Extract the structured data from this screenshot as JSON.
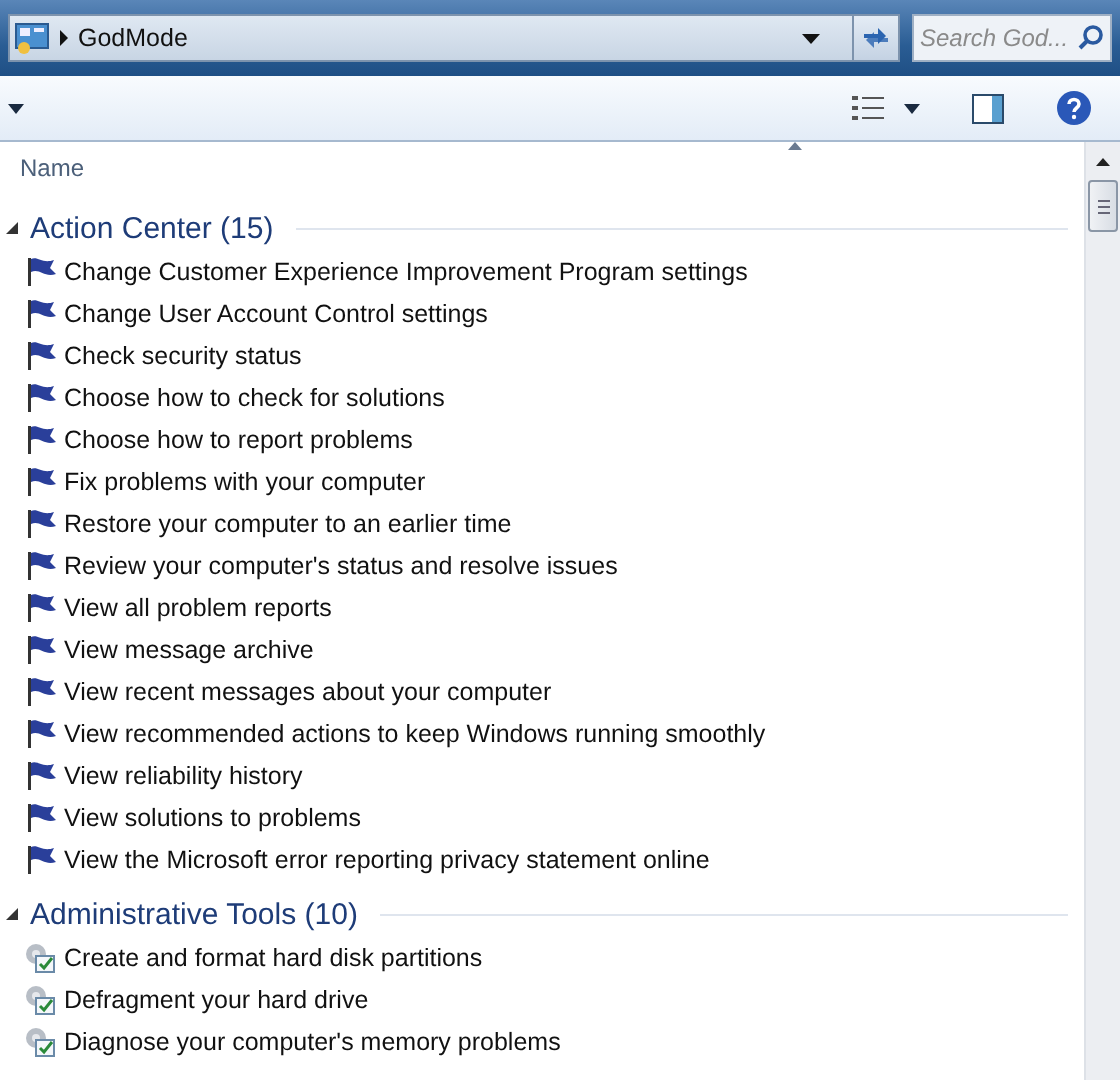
{
  "address_bar": {
    "path": "GodMode"
  },
  "search": {
    "placeholder": "Search God..."
  },
  "column_header": {
    "label": "Name"
  },
  "groups": [
    {
      "title": "Action Center (15)",
      "expanded": true,
      "items": [
        {
          "kind": "flag",
          "label": "Change Customer Experience Improvement Program settings"
        },
        {
          "kind": "flag",
          "label": "Change User Account Control settings"
        },
        {
          "kind": "flag",
          "label": "Check security status"
        },
        {
          "kind": "flag",
          "label": "Choose how to check for solutions"
        },
        {
          "kind": "flag",
          "label": "Choose how to report problems"
        },
        {
          "kind": "flag",
          "label": "Fix problems with your computer"
        },
        {
          "kind": "flag",
          "label": "Restore your computer to an earlier time"
        },
        {
          "kind": "flag",
          "label": "Review your computer's status and resolve issues"
        },
        {
          "kind": "flag",
          "label": "View all problem reports"
        },
        {
          "kind": "flag",
          "label": "View message archive"
        },
        {
          "kind": "flag",
          "label": "View recent messages about your computer"
        },
        {
          "kind": "flag",
          "label": "View recommended actions to keep Windows running smoothly"
        },
        {
          "kind": "flag",
          "label": "View reliability history"
        },
        {
          "kind": "flag",
          "label": "View solutions to problems"
        },
        {
          "kind": "flag",
          "label": "View the Microsoft error reporting privacy statement online"
        }
      ]
    },
    {
      "title": "Administrative Tools (10)",
      "expanded": true,
      "items": [
        {
          "kind": "tool",
          "label": "Create and format hard disk partitions"
        },
        {
          "kind": "tool",
          "label": "Defragment your hard drive"
        },
        {
          "kind": "tool",
          "label": "Diagnose your computer's memory problems"
        }
      ]
    }
  ]
}
